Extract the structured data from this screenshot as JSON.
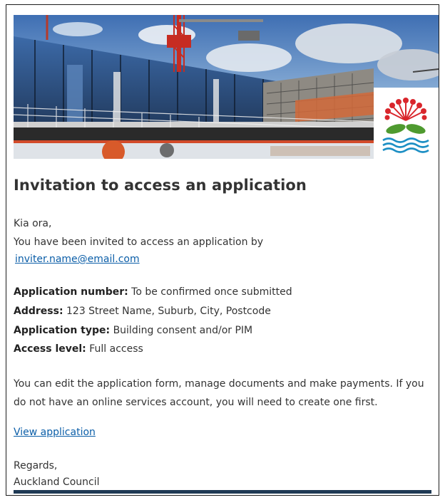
{
  "email": {
    "title": "Invitation to access an application",
    "greeting": "Kia ora,",
    "intro": "You have been invited to access an application by",
    "inviter_email": "inviter.name@email.com",
    "details": [
      {
        "label": "Application number:",
        "value": "To be confirmed once submitted"
      },
      {
        "label": "Address:",
        "value": "123 Street Name, Suburb, City, Postcode"
      },
      {
        "label": "Application type:",
        "value": "Building consent and/or PIM"
      },
      {
        "label": "Access level:",
        "value": "Full access"
      }
    ],
    "description": "You can edit the application form, manage documents and make payments. If you do not have an online services account, you will need to create one first.",
    "view_link": "View application",
    "sign_off": "Regards,",
    "sender": "Auckland Council"
  },
  "banner": {
    "image": "construction-site-photo",
    "logo": "pohutukawa-council-logo-icon"
  },
  "colors": {
    "link": "#0b5ea8",
    "text": "#333333",
    "footer_bar": "#1f3a54",
    "logo_red": "#d9262c",
    "logo_green": "#4e9a2f",
    "logo_blue": "#1d8fc4"
  }
}
